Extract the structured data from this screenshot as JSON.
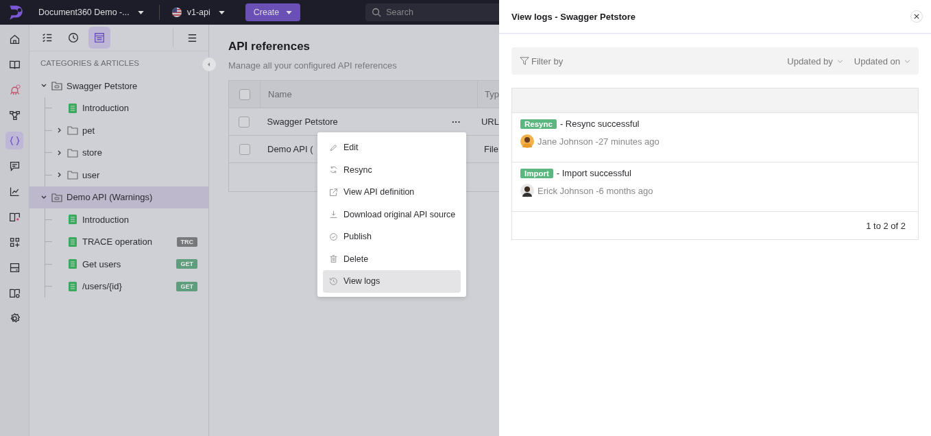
{
  "topbar": {
    "project": "Document360 Demo -...",
    "version": "v1-api",
    "create": "Create",
    "search": {
      "placeholder": "Search"
    }
  },
  "rail": [
    {
      "selected": false
    },
    {
      "selected": false
    },
    {
      "selected": false
    },
    {
      "selected": false
    },
    {
      "selected": true
    },
    {
      "selected": false
    },
    {
      "selected": false
    },
    {
      "selected": false
    },
    {
      "selected": false
    },
    {
      "selected": false
    },
    {
      "selected": false
    },
    {
      "selected": false
    }
  ],
  "tree_toolbar": [
    {
      "selected": false
    },
    {
      "selected": false
    },
    {
      "selected": true
    }
  ],
  "tree": {
    "heading": "CATEGORIES & ARTICLES",
    "items": [
      {
        "label": "Swagger Petstore",
        "kind": "api",
        "expanded": true,
        "selected": false,
        "children": [
          {
            "label": "Introduction",
            "kind": "article"
          },
          {
            "label": "pet",
            "kind": "folder",
            "expanded": false
          },
          {
            "label": "store",
            "kind": "folder",
            "expanded": false
          },
          {
            "label": "user",
            "kind": "folder",
            "expanded": false
          }
        ]
      },
      {
        "label": "Demo API (Warnings)",
        "kind": "api",
        "expanded": true,
        "selected": true,
        "children": [
          {
            "label": "Introduction",
            "kind": "article"
          },
          {
            "label": "TRACE operation",
            "kind": "article",
            "method": "TRC",
            "color": "#77787c"
          },
          {
            "label": "Get users",
            "kind": "article",
            "method": "GET",
            "color": "#5e9e7c"
          },
          {
            "label": "/users/{id}",
            "kind": "article",
            "method": "GET",
            "color": "#5e9e7c"
          }
        ]
      }
    ]
  },
  "main": {
    "title": "API references",
    "subtitle": "Manage all your configured API references",
    "table": {
      "all_checked": false,
      "columns": [
        "Name",
        "Typ"
      ],
      "rows": [
        {
          "checked": false,
          "name": "Swagger Petstore",
          "type": "URL",
          "menu": "···"
        },
        {
          "checked": false,
          "name": "Demo API (",
          "type": "File"
        }
      ]
    }
  },
  "context_menu": [
    {
      "label": "Edit",
      "selected": false
    },
    {
      "label": "Resync",
      "selected": false
    },
    {
      "label": "View API definition",
      "selected": false
    },
    {
      "label": "Download original API source",
      "selected": false
    },
    {
      "label": "Publish",
      "selected": false
    },
    {
      "label": "Delete",
      "selected": false
    },
    {
      "label": "View logs",
      "selected": true
    }
  ],
  "drawer": {
    "title": "View logs - Swagger Petstore",
    "filter": "Filter by",
    "dropdowns": [
      "Updated by",
      "Updated on"
    ],
    "logs": [
      {
        "tag": "Resync",
        "color": "#5cb67f",
        "message": "- Resync successful",
        "author": "Jane Johnson -27 minutes ago"
      },
      {
        "tag": "Import",
        "color": "#5cb67f",
        "message": "- Import successful",
        "author": "Erick Johnson -6 months ago"
      }
    ],
    "pagination": "1 to 2 of 2"
  }
}
